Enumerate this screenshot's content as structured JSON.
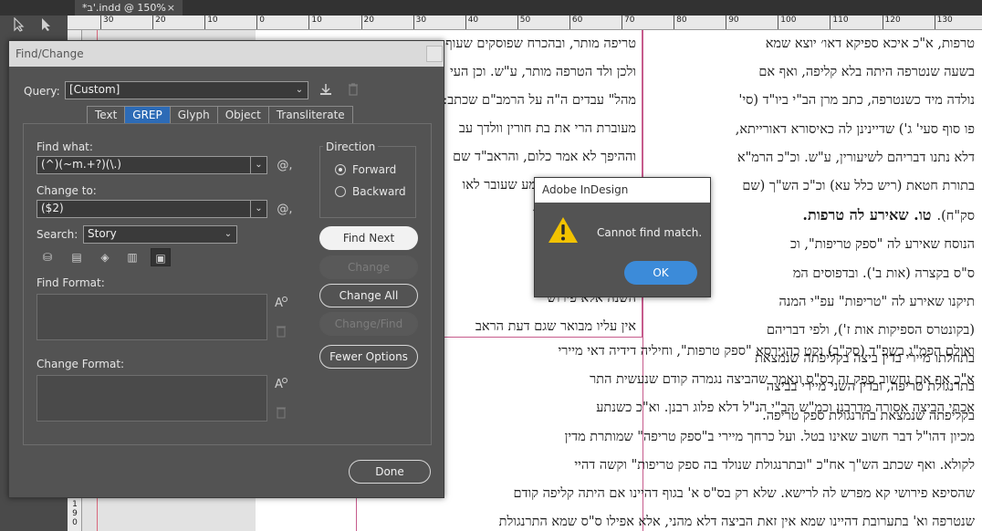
{
  "document_tab": {
    "title": "*ב'.indd @ 150%",
    "close": "×"
  },
  "ruler": {
    "horizontal": [
      "30",
      "20",
      "10",
      "0",
      "10",
      "20",
      "30",
      "40",
      "50",
      "60",
      "70",
      "80",
      "90",
      "100",
      "110",
      "120",
      "130",
      "140",
      "150",
      "160",
      "170",
      "180"
    ],
    "vertical_label": "1 9 0"
  },
  "page_text": {
    "left_column": [
      "טריפה מותר, ובהכרח שפוסקים שעוף",
      "ולכן ולד הטרפה מותר, ע\"ש. וכן העי",
      "מהל\" עבדים ה\"ה על הרמב\"ם שכתב:",
      "מעוברת הרי את בת חורין וולדך עב",
      "וההיפך לא אמר כלום, והראב\"ד שם",
      "אסיפא דברישא משמע שעובר לאו",
      "דברישא דבריו קיימין",
      "אסיפא לא אמר כל",
      "שרור לחבירו מידי",
      "השנה אלא פירוש",
      "אין עליו מבואר שגם דעת הראב",
      "מבואר באור זרוע (פ\"ד דב\"מ סי' קפ"
    ],
    "right_column": [
      "טרפות, א\"כ איכא ספיקא דאו׳ יוצא שמא",
      "בשעה שנטרפה היתה בלא קליפה, ואף אם",
      "נולדה מיד כשנטרפה, כתב מרן הב\"י ביו\"ד (סי'",
      "פו סוף סעי' ג') שדיינינן לה כאיסורא דאורייתא,",
      "דלא נתנו דבריהם לשיעורין, ע\"ש. וכ\"כ הרמ\"א",
      "בתורת חטאת (ריש כלל עא) וכ\"כ הש\"ך (שם",
      "סק\"ח).",
      "הנוסח שאירע לה \"ספק טריפות\", וכ",
      "ס\"ס בקצרה (אות ב'). ובדפוסים המ",
      "תיקנו שאירע לה \"טריפות\" עפ\"י המנה",
      "(בקונטרס הספיקות אות ז'), ולפי דבריהם",
      "בתחלתו מיירי בדין ביצה בקליפתה שנמצאת",
      "בתרנגולת טריפה, ובדין השני מיירי בביצה",
      "בקליפתה שנמצאת בתרנגולת ספק טריפה."
    ],
    "heading": "טו. שאירע לה טרפות.",
    "bottom_column": [
      "ואולם הפמ\"ג בשפ\"ד (סק\"ב) נקט כהגירסא \"ספק טרפות\", וחיליה דידיה דאי מיירי",
      "א\"כ אף אם נחשוב ספק זה כס\"ס ונאמר שהביצה נגמרה קודם שנעשית התר",
      "אכתי הביצה אסורה מדרבנן וכמ\"ש הב\"י הנ\"ל דלא פלוג רבנן. וא\"כ כשנתע",
      "מכיון דהו\"ל דבר חשוב שאינו בטל. ועל כרחך מיירי ב\"ספק טריפה\" שמותרת מדין",
      "לקולא. ואף שכתב הש\"ך אח\"כ \"ובתרנגולת שנולד בה ספק טריפות\" וקשה דהיי",
      "שהסיפא פירושי קא מפרש לה לרישא. שלא רק בס\"ס א' בגוף דהיינו אם היתה קליפה קודם",
      "שנטרפה וא' בתערובת דהיינו שמא אין זאת הביצה דלא מהני, אלא אפילו ס\"ס שמא התרנגולת"
    ]
  },
  "find_change": {
    "title": "Find/Change",
    "query_label": "Query:",
    "query_value": "[Custom]",
    "tabs": [
      "Text",
      "GREP",
      "Glyph",
      "Object",
      "Transliterate"
    ],
    "active_tab": "GREP",
    "find_what_label": "Find what:",
    "find_what_value": "(^)(~m.+?)(\\.)",
    "change_to_label": "Change to:",
    "change_to_value": "($2)",
    "search_label": "Search:",
    "search_value": "Story",
    "find_format_label": "Find Format:",
    "change_format_label": "Change Format:",
    "direction_label": "Direction",
    "forward_label": "Forward",
    "backward_label": "Backward",
    "direction_selected": "Forward",
    "buttons": {
      "find_next": "Find Next",
      "change": "Change",
      "change_all": "Change All",
      "change_find": "Change/Find",
      "fewer_options": "Fewer Options",
      "done": "Done"
    },
    "special_char_symbol": "@,"
  },
  "alert": {
    "title": "Adobe InDesign",
    "message": "Cannot find match.",
    "ok": "OK"
  },
  "colors": {
    "accent": "#2d6bb6",
    "ok_button": "#3c8bd9",
    "frame_edge": "#c65b8c",
    "dialog_bg": "#535353"
  }
}
